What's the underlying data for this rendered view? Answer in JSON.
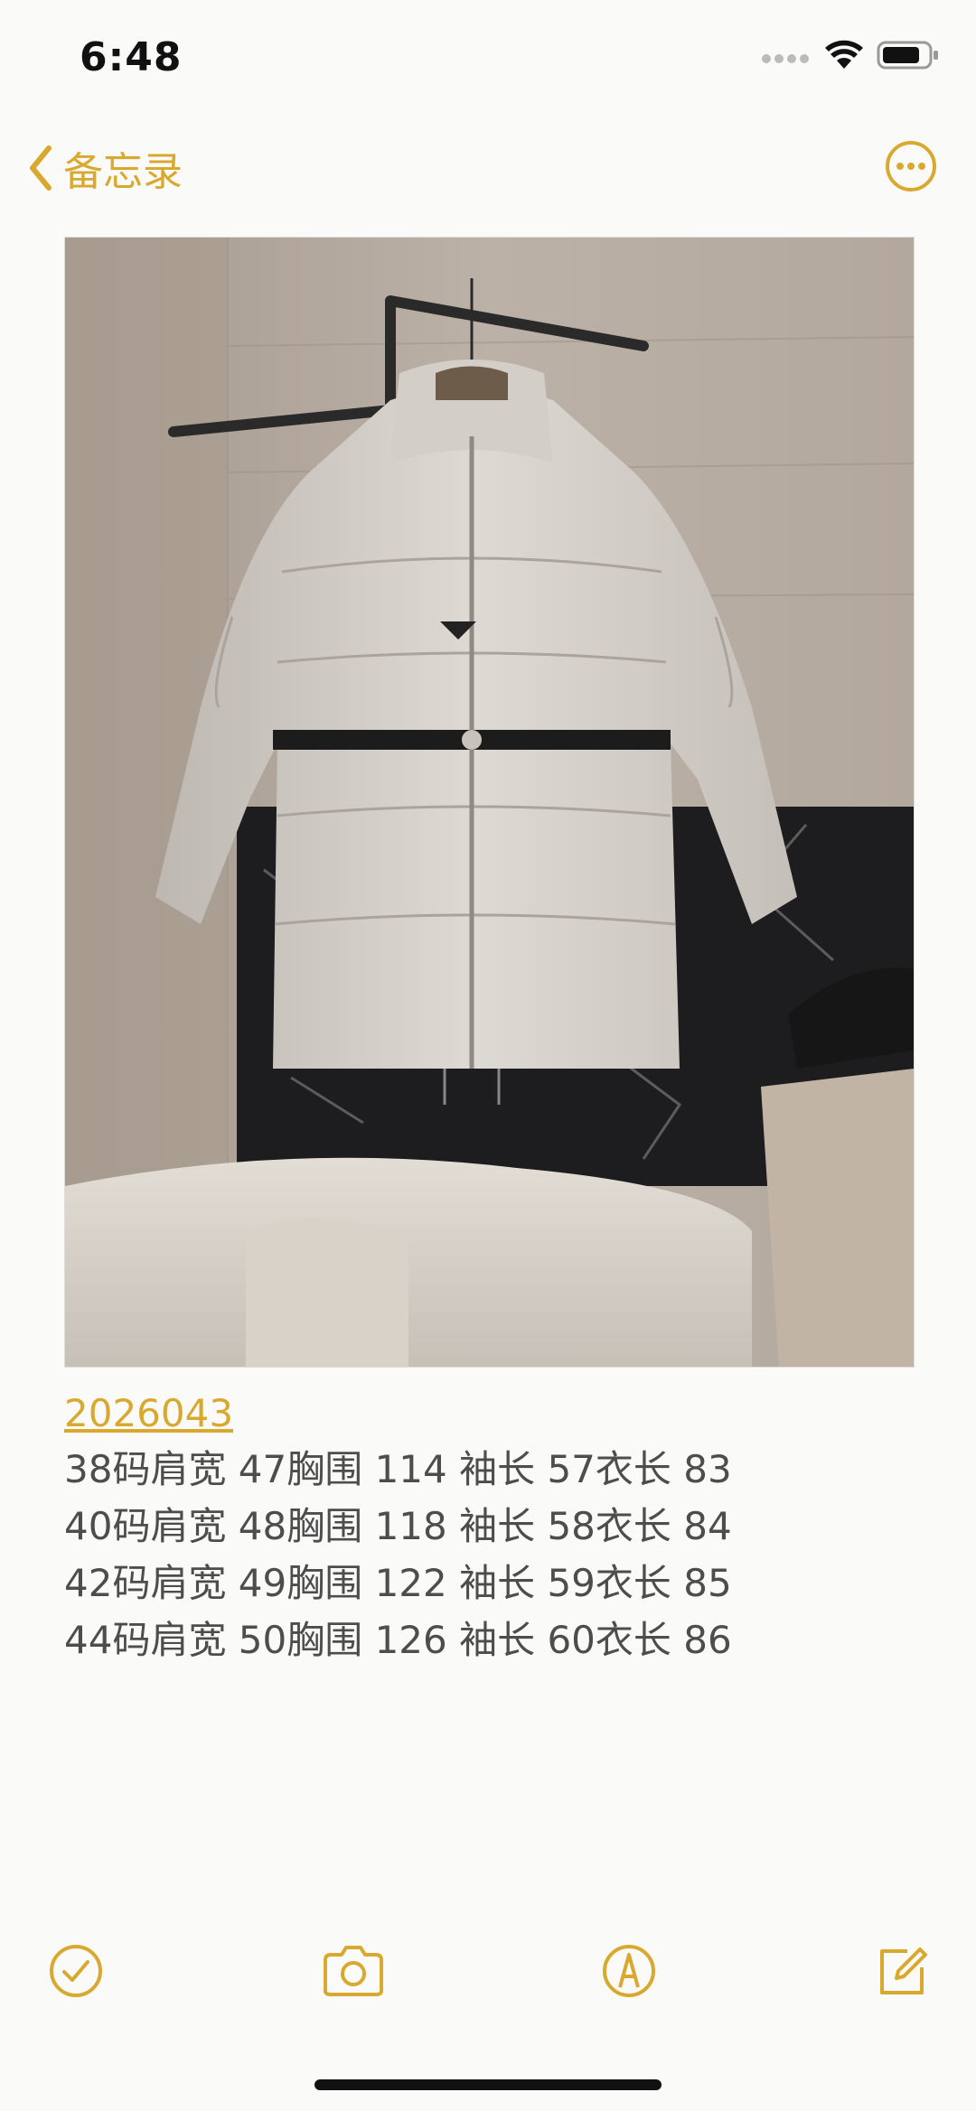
{
  "status_bar": {
    "time": "6:48"
  },
  "nav": {
    "back_label": "备忘录",
    "accent": "#d9a92f"
  },
  "note": {
    "link": "2026043",
    "lines": [
      "38码肩宽 47胸围 114 袖长 57衣长 83",
      "40码肩宽 48胸围 118 袖长 58衣长 84",
      "42码肩宽 49胸围 122 袖长 59衣长 85",
      "44码肩宽 50胸围 126 袖长 60衣长 86"
    ]
  },
  "toolbar": {
    "icons": [
      "checklist-icon",
      "camera-icon",
      "markup-icon",
      "compose-icon"
    ]
  }
}
